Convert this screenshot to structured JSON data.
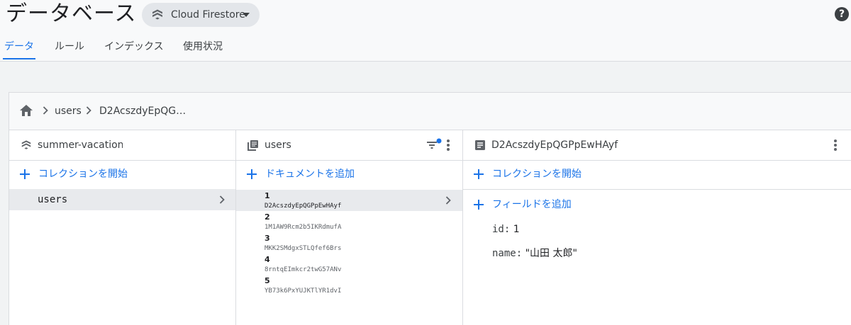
{
  "header": {
    "title": "データベース",
    "db_selector": "Cloud Firestore",
    "help": "?"
  },
  "tabs": [
    {
      "label": "データ",
      "active": true
    },
    {
      "label": "ルール",
      "active": false
    },
    {
      "label": "インデックス",
      "active": false
    },
    {
      "label": "使用状況",
      "active": false
    }
  ],
  "breadcrumb": {
    "items": [
      "users",
      "D2AcszdyEpQG…"
    ]
  },
  "root_column": {
    "title": "summer-vacation-",
    "add_label": "コレクションを開始",
    "collections": [
      "users"
    ]
  },
  "collection_column": {
    "title": "users",
    "add_label": "ドキュメントを追加",
    "documents": [
      {
        "num": "1",
        "id": "D2AcszdyEpQGPpEwHAyf"
      },
      {
        "num": "2",
        "id": "1M1AW9Rcm2b5IKRdmufA"
      },
      {
        "num": "3",
        "id": "MKK2SMdgxSTLQfef6Brs"
      },
      {
        "num": "4",
        "id": "8rntqEImkcr2twG57ANv"
      },
      {
        "num": "5",
        "id": "YB73k6PxYUJKTlYR1dvI"
      }
    ]
  },
  "document_column": {
    "title": "D2AcszdyEpQGPpEwHAyf",
    "add_collection_label": "コレクションを開始",
    "add_field_label": "フィールドを追加",
    "fields": [
      {
        "key": "id:",
        "value": "1"
      },
      {
        "key": "name:",
        "value": "\"山田 太郎\""
      }
    ]
  },
  "colors": {
    "accent": "#1a73e8",
    "text": "#202124",
    "border": "#dadce0"
  }
}
